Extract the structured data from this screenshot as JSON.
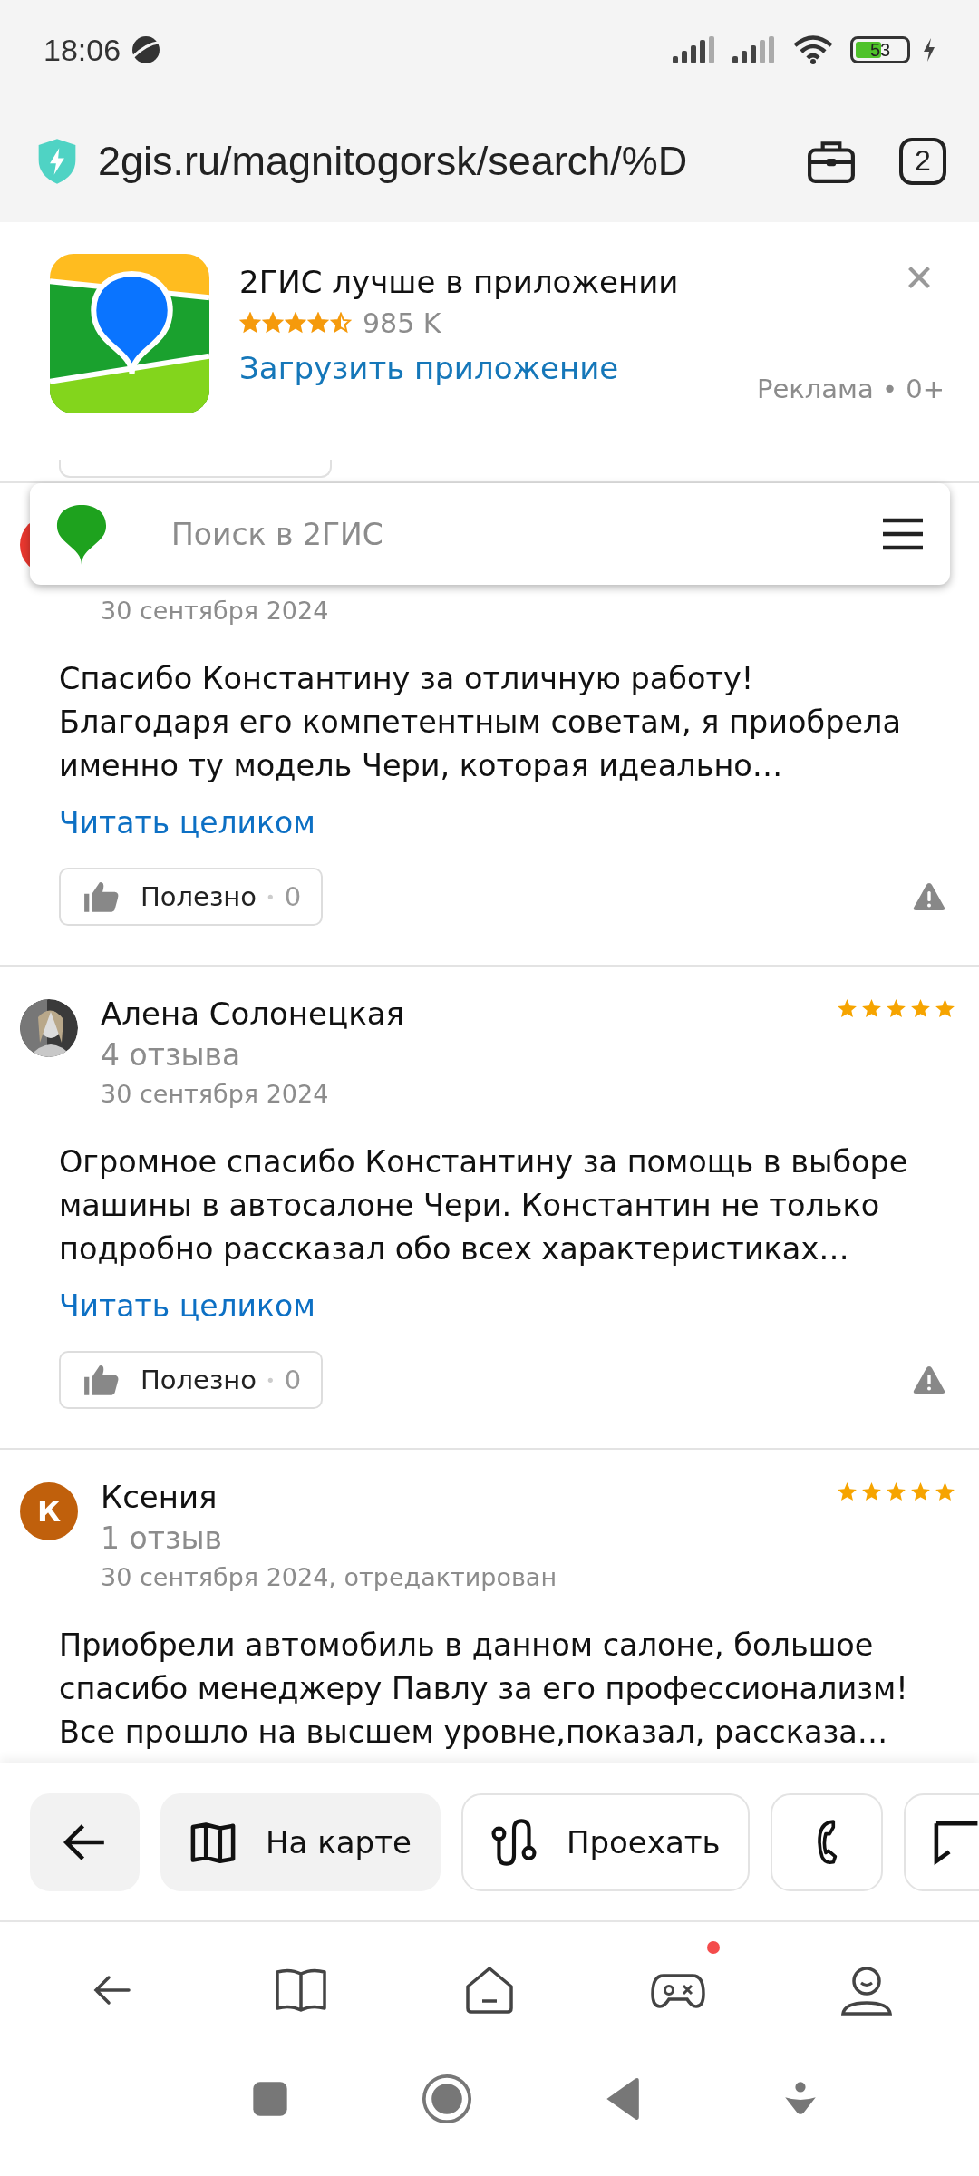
{
  "status_bar": {
    "time": "18:06",
    "battery": "53"
  },
  "address_bar": {
    "url": "2gis.ru/magnitogorsk/search/%D",
    "tab_count": "2"
  },
  "ad": {
    "title": "2ГИС лучше в приложении",
    "stars": 4.5,
    "rating_count": "985 K",
    "link": "Загрузить приложение",
    "label": "Реклама • 0+"
  },
  "search": {
    "placeholder": "Поиск в 2ГИС"
  },
  "reviews": [
    {
      "avatar": {
        "kind": "letter",
        "color": "#e8372f"
      },
      "date": "30 сентября 2024",
      "text": "Спасибо Константину за отличную работу! Благодаря его компетентным советам, я приобрела именно ту модель Чери, которая идеально…",
      "read_more": "Читать целиком",
      "useful": {
        "label": "Полезно",
        "separator": "•",
        "count": "0"
      }
    },
    {
      "name": "Алена Солонецкая",
      "count": "4 отзыва",
      "date": "30 сентября 2024",
      "stars": 5,
      "text": "Огромное спасибо Константину за помощь в выборе машины в автосалоне Чери. Константин не только подробно рассказал обо всех характеристиках…",
      "read_more": "Читать целиком",
      "useful": {
        "label": "Полезно",
        "separator": "•",
        "count": "0"
      }
    },
    {
      "avatar": {
        "kind": "letter",
        "letter": "К",
        "color": "#c0600c"
      },
      "name": "Ксения",
      "count": "1 отзыв",
      "date": "30 сентября 2024, отредактирован",
      "stars": 5,
      "text": "Приобрели автомобиль в данном салоне, большое спасибо менеджеру Павлу за его профессионализм! Все прошло на высшем уровне,показал, рассказа…"
    }
  ],
  "actions": [
    {
      "kind": "back",
      "filled": true
    },
    {
      "kind": "map",
      "label": "На карте",
      "filled": true
    },
    {
      "kind": "route",
      "label": "Проехать",
      "filled": false
    },
    {
      "kind": "phone",
      "filled": false
    },
    {
      "kind": "chat",
      "filled": false
    }
  ],
  "browser_nav": [
    {
      "kind": "back",
      "badge": false
    },
    {
      "kind": "bookmarks",
      "badge": false
    },
    {
      "kind": "home",
      "badge": false
    },
    {
      "kind": "games",
      "badge": true
    },
    {
      "kind": "profile",
      "badge": false
    }
  ],
  "system_nav": [
    {
      "kind": "recents"
    },
    {
      "kind": "home"
    },
    {
      "kind": "back"
    },
    {
      "kind": "assist"
    }
  ]
}
